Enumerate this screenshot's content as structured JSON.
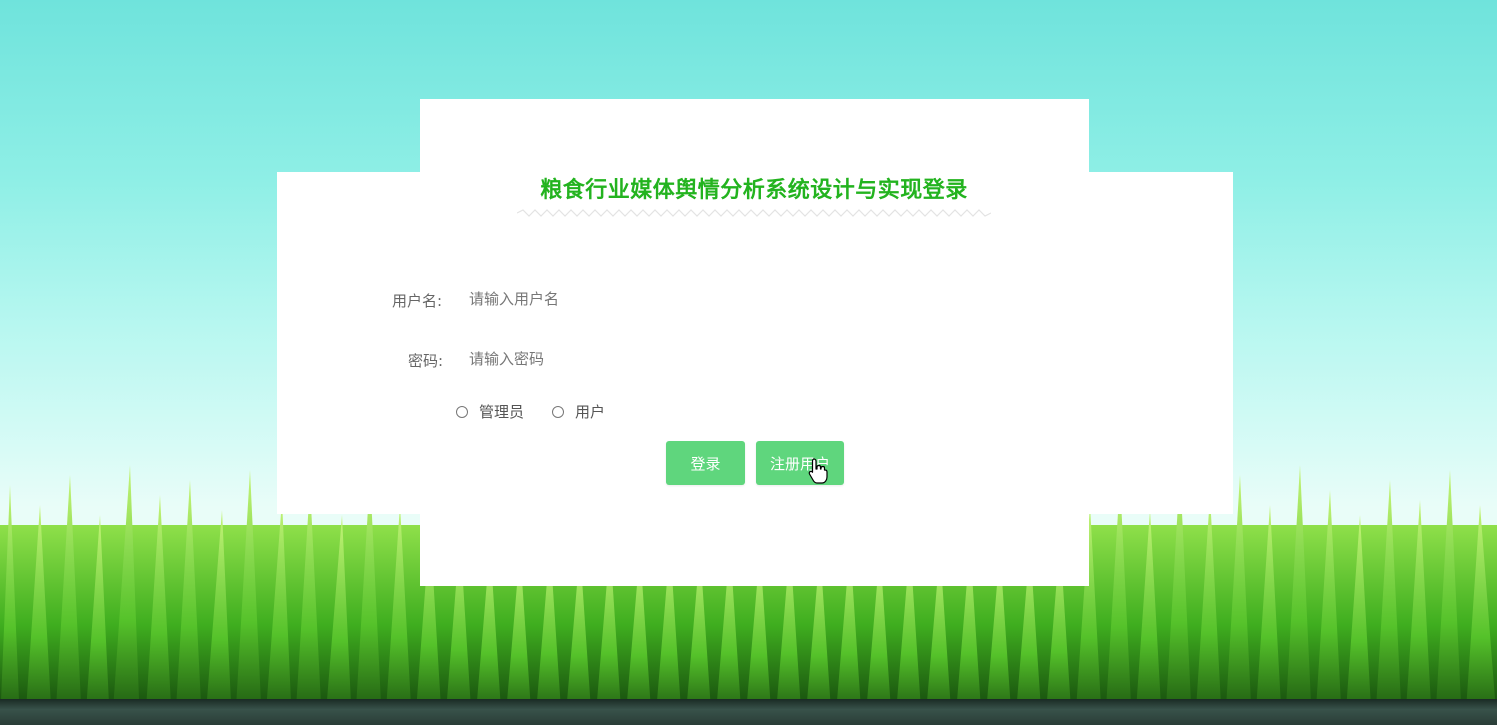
{
  "login": {
    "title": "粮食行业媒体舆情分析系统设计与实现登录",
    "username_label": "用户名:",
    "username_placeholder": "请输入用户名",
    "password_label": "密码:",
    "password_placeholder": "请输入密码",
    "roles": [
      "管理员",
      "用户"
    ],
    "login_button": "登录",
    "register_button": "注册用户"
  },
  "colors": {
    "title": "#23b31f",
    "button": "#5fd67d",
    "sky_top": "#6fe3dc",
    "grass": "#3fae1f"
  },
  "icons": {
    "cursor": "hand-pointer-icon"
  }
}
